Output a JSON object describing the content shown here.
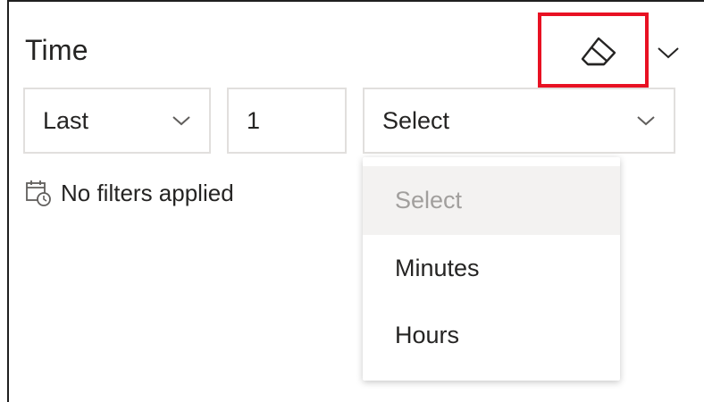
{
  "panel": {
    "title": "Time"
  },
  "icons": {
    "clear_filter": "eraser-icon",
    "collapse": "chevron-down-icon",
    "status": "calendar-clock-icon",
    "dropdown_chevron": "chevron-down-icon"
  },
  "filters": {
    "relative_mode": "Last",
    "amount": "1",
    "unit": "Select"
  },
  "status": {
    "text": "No filters applied"
  },
  "unit_dropdown": {
    "options": [
      "Select",
      "Minutes",
      "Hours"
    ]
  },
  "colors": {
    "highlight": "#e81123",
    "border": "#e1dfdd",
    "placeholder_text": "#a19f9d",
    "placeholder_bg": "#f3f2f1"
  }
}
